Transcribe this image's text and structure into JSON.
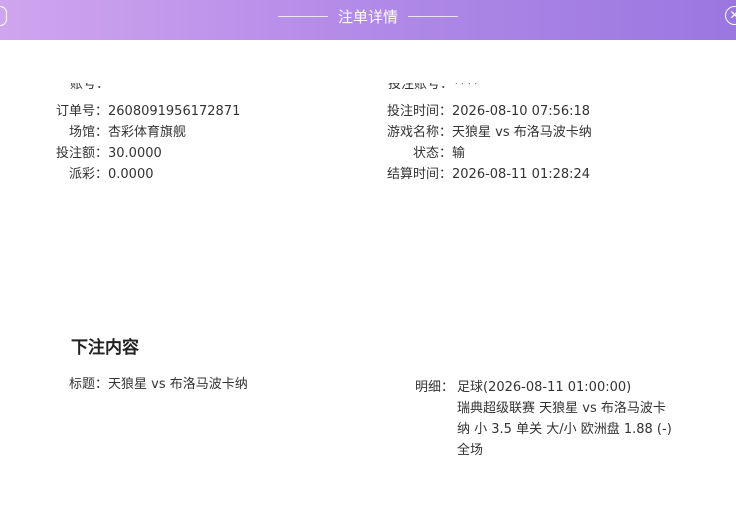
{
  "header": {
    "title": "注单详情",
    "close_glyph": "✕"
  },
  "cut_row": {
    "left_label": "账号：",
    "right_label": "投注账号：",
    "right_value": "****"
  },
  "left_info": [
    {
      "label": "订单号：",
      "value": "2608091956172871"
    },
    {
      "label": "场馆：",
      "value": "杏彩体育旗舰"
    },
    {
      "label": "投注额：",
      "value": "30.0000"
    },
    {
      "label": "派彩：",
      "value": "0.0000"
    }
  ],
  "right_info": [
    {
      "label": "投注时间：",
      "value": "2026-08-10 07:56:18"
    },
    {
      "label": "游戏名称：",
      "value": "天狼星 vs 布洛马波卡纳"
    },
    {
      "label": "状态：",
      "value": "输"
    },
    {
      "label": "结算时间：",
      "value": "2026-08-11 01:28:24"
    }
  ],
  "bet_content": {
    "section_title": "下注内容",
    "title_label": "标题：",
    "title_value": "天狼星 vs 布洛马波卡纳",
    "detail_label": "明细：",
    "detail_value": "足球(2026-08-11 01:00:00)\n瑞典超级联赛 天狼星 vs 布洛马波卡\n纳 小 3.5 单关 大/小 欧洲盘 1.88 (-)\n全场"
  }
}
